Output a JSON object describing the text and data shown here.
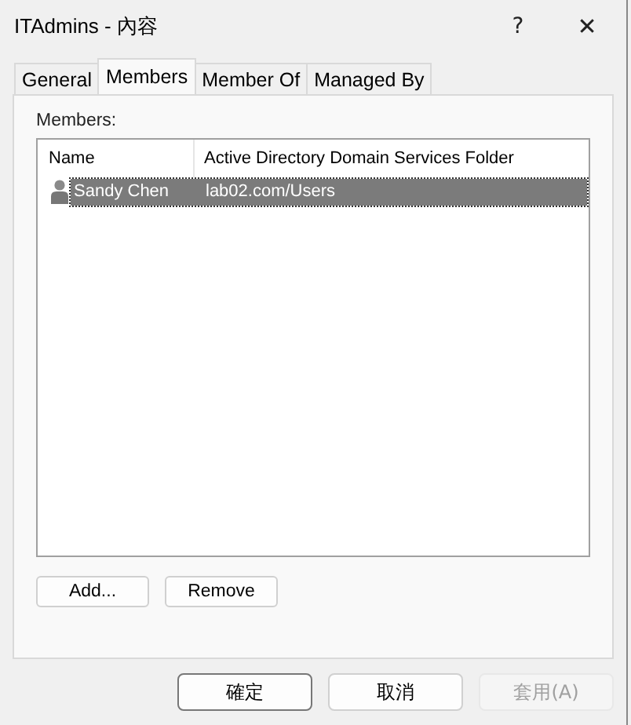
{
  "window": {
    "title": "ITAdmins - 內容",
    "help": "?",
    "close": "✕"
  },
  "tabs": [
    {
      "label": "General",
      "selected": false
    },
    {
      "label": "Members",
      "selected": true
    },
    {
      "label": "Member Of",
      "selected": false
    },
    {
      "label": "Managed By",
      "selected": false
    }
  ],
  "members_label": "Members:",
  "table": {
    "columns": [
      "Name",
      "Active Directory Domain Services Folder"
    ],
    "rows": [
      {
        "name": "Sandy Chen",
        "folder": "lab02.com/Users",
        "selected": true
      }
    ]
  },
  "list_buttons": [
    "Add...",
    "Remove"
  ],
  "dialog_buttons": [
    {
      "label": "確定",
      "default": true,
      "disabled": false
    },
    {
      "label": "取消",
      "default": false,
      "disabled": false
    },
    {
      "label": "套用(A)",
      "default": false,
      "disabled": true
    }
  ]
}
